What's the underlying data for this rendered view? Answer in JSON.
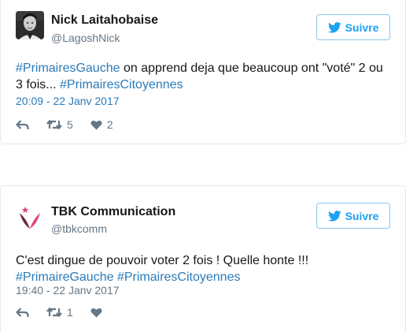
{
  "tweets": [
    {
      "name": "Nick Laitahobaise",
      "handle": "@LagoshNick",
      "follow_label": "Suivre",
      "text_parts": [
        {
          "tag": "#PrimairesGauche"
        },
        {
          "plain": " on apprend deja que beaucoup ont \"voté\" 2 ou 3 fois... "
        },
        {
          "tag": "#PrimairesCitoyennes"
        }
      ],
      "tag1": "#PrimairesGauche",
      "plain1": " on apprend deja que beaucoup ont \"voté\" 2 ou 3 fois... ",
      "tag2": "#PrimairesCitoyennes",
      "timestamp": "20:09 - 22 Janv 2017",
      "retweets": "5",
      "likes": "2"
    },
    {
      "name": "TBK Communication",
      "handle": "@tbkcomm",
      "follow_label": "Suivre",
      "plain1": "C'est dingue de pouvoir voter 2 fois ! Quelle honte !!!",
      "tag1": "#PrimaireGauche",
      "tag2": "#PrimairesCitoyennes",
      "timestamp": "19:40 - 22 Janv 2017",
      "retweets": "1",
      "likes": ""
    }
  ],
  "colors": {
    "link": "#2b7bb9",
    "follow_accent": "#1da1f2",
    "meta_gray": "#657786",
    "border": "#e1e8ed",
    "logo_pink": "#e0407a",
    "logo_dark": "#6b2a3a"
  },
  "icons": [
    "reply-icon",
    "retweet-icon",
    "heart-icon",
    "twitter-bird-icon"
  ]
}
